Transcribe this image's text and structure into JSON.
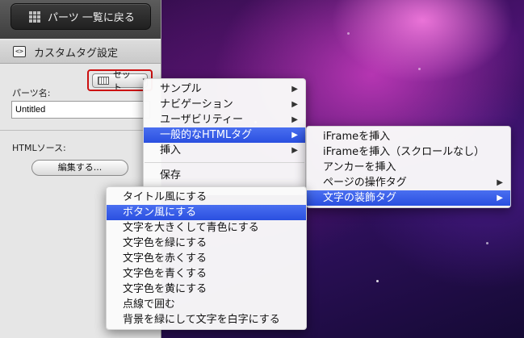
{
  "panel": {
    "back_button": "パーツ 一覧に戻る",
    "section_title": "カスタムタグ設定",
    "set_button": "セット",
    "parts_name_label": "パーツ名:",
    "parts_name_value": "Untitled",
    "html_source_label": "HTMLソース:",
    "edit_button": "編集する..."
  },
  "main_menu": {
    "items": [
      {
        "label": "サンプル",
        "arrow": "▶"
      },
      {
        "label": "ナビゲーション",
        "arrow": "▶"
      },
      {
        "label": "ユーザビリティー",
        "arrow": "▶"
      },
      {
        "label": "一般的なHTMLタグ",
        "arrow": "▶"
      },
      {
        "label": "挿入",
        "arrow": "▶"
      },
      {
        "label": "保存",
        "arrow": ""
      }
    ]
  },
  "sub_menu": {
    "items": [
      {
        "label": "iFrameを挿入",
        "arrow": ""
      },
      {
        "label": "iFrameを挿入（スクロールなし）",
        "arrow": ""
      },
      {
        "label": "アンカーを挿入",
        "arrow": ""
      },
      {
        "label": "ページの操作タグ",
        "arrow": "▶"
      },
      {
        "label": "文字の装飾タグ",
        "arrow": "▶"
      }
    ]
  },
  "deco_menu": {
    "items": [
      {
        "label": "タイトル風にする"
      },
      {
        "label": "ボタン風にする"
      },
      {
        "label": "文字を大きくして青色にする"
      },
      {
        "label": "文字色を緑にする"
      },
      {
        "label": "文字色を赤くする"
      },
      {
        "label": "文字色を青くする"
      },
      {
        "label": "文字色を黄にする"
      },
      {
        "label": "点線で囲む"
      },
      {
        "label": "背景を緑にして文字を白字にする"
      }
    ]
  },
  "colors": {
    "selection": "#2f55e4",
    "highlight_box": "#cc1010"
  }
}
